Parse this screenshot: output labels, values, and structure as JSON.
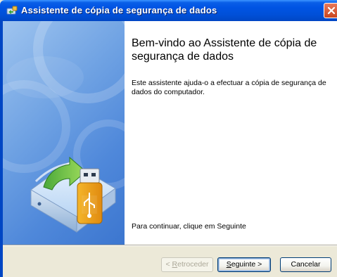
{
  "window": {
    "title": "Assistente de cópia de segurança de dados",
    "icon": "backup-wizard-icon",
    "close_icon": "close-icon"
  },
  "content": {
    "heading": "Bem-vindo ao Assistente de cópia de segurança de dados",
    "intro": "Este assistente ajuda-o a efectuar a cópia de segurança de dados do computador.",
    "continue": "Para continuar, clique em Seguinte"
  },
  "buttons": {
    "back_prefix": "< ",
    "back_hotkey": "R",
    "back_rest": "etroceder",
    "next_hotkey": "S",
    "next_rest": "eguinte >",
    "cancel": "Cancelar"
  },
  "banner": {
    "illustration": "usb-drive-backup-icon"
  },
  "colors": {
    "titlebar": "#0054e3",
    "banner": "#6fa2e3",
    "dialog": "#ece9d8"
  }
}
